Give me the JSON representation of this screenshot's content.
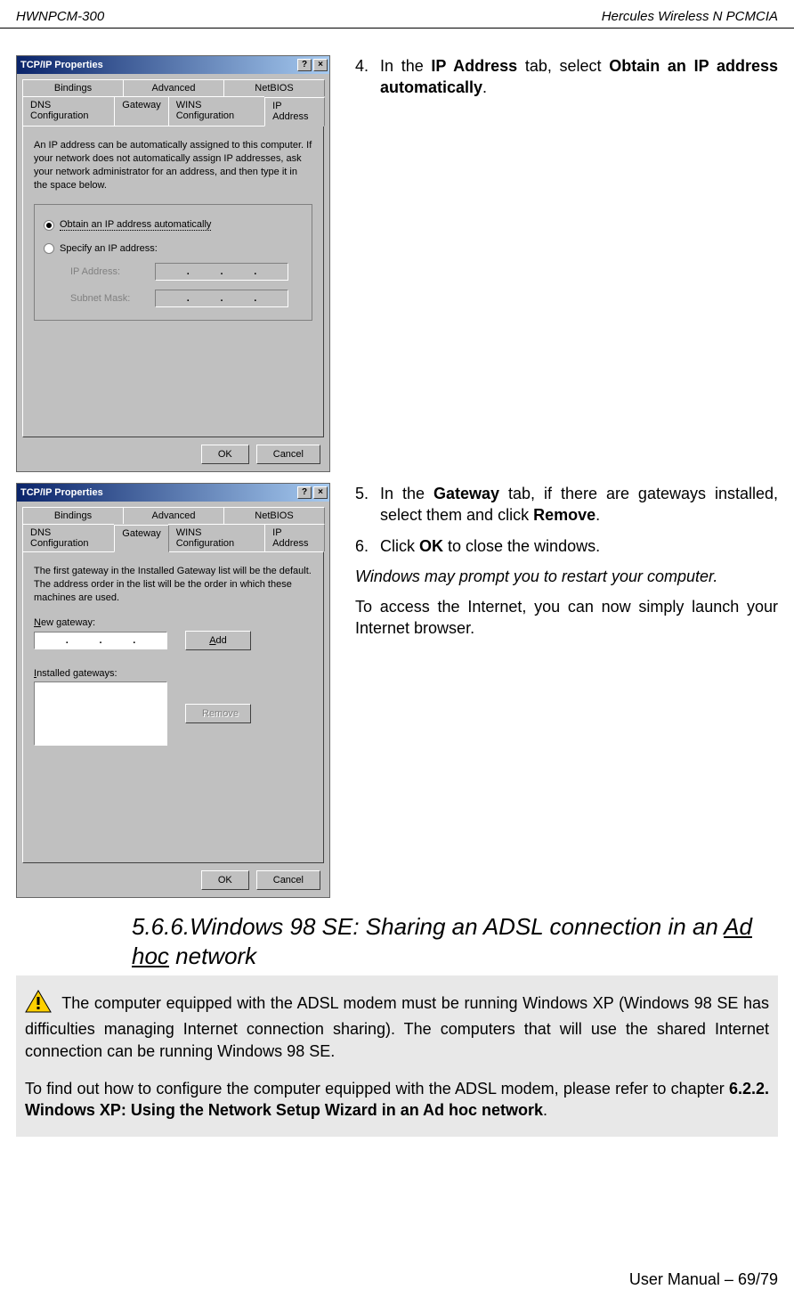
{
  "header": {
    "left": "HWNPCM-300",
    "right": "Hercules Wireless N PCMCIA"
  },
  "dialog1": {
    "title": "TCP/IP Properties",
    "help": "?",
    "close": "×",
    "tabs_row1": [
      "Bindings",
      "Advanced",
      "NetBIOS"
    ],
    "tabs_row2": [
      "DNS Configuration",
      "Gateway",
      "WINS Configuration",
      "IP Address"
    ],
    "desc": "An IP address can be automatically assigned to this computer. If your network does not automatically assign IP addresses, ask your network administrator for an address, and then type it in the space below.",
    "radio_auto": "Obtain an IP address automatically",
    "radio_specify": "Specify an IP address:",
    "ip_label": "IP Address:",
    "mask_label": "Subnet Mask:",
    "ok": "OK",
    "cancel": "Cancel"
  },
  "instr1": {
    "num": "4.",
    "text_a": "In the ",
    "text_b": "IP Address",
    "text_c": " tab, select ",
    "text_d": "Obtain an IP address automatically",
    "text_e": "."
  },
  "dialog2": {
    "title": "TCP/IP Properties",
    "help": "?",
    "close": "×",
    "tabs_row1": [
      "Bindings",
      "Advanced",
      "NetBIOS"
    ],
    "tabs_row2": [
      "DNS Configuration",
      "Gateway",
      "WINS Configuration",
      "IP Address"
    ],
    "desc": "The first gateway in the Installed Gateway list will be the default. The address order in the list will be the order in which these machines are used.",
    "new_gw": "New gateway:",
    "add": "Add",
    "installed": "Installed gateways:",
    "remove": "Remove",
    "ok": "OK",
    "cancel": "Cancel"
  },
  "instr2": {
    "s5_num": "5.",
    "s5_a": "In the ",
    "s5_b": "Gateway",
    "s5_c": " tab, if there are gateways installed, select them and click ",
    "s5_d": "Remove",
    "s5_e": ".",
    "s6_num": "6.",
    "s6_a": "Click ",
    "s6_b": "OK",
    "s6_c": " to close the windows.",
    "prompt": "Windows may prompt you to restart your computer.",
    "access": "To access the Internet, you can now simply launch your Internet browser."
  },
  "section": {
    "num": "5.6.6.",
    "title_a": "Windows 98 SE: Sharing an ADSL connection in an ",
    "title_b": "Ad hoc",
    "title_c": " network"
  },
  "note": {
    "p1": " The computer equipped with the ADSL modem must be running Windows XP (Windows 98 SE has difficulties managing Internet connection sharing).  The computers that will use the shared Internet connection can be running Windows 98 SE.",
    "p2_a": "To find out how to configure the computer equipped with the ADSL modem, please refer to chapter ",
    "p2_b": "6.2.2. Windows XP: Using the Network Setup Wizard in an Ad hoc network",
    "p2_c": "."
  },
  "footer": "User Manual – 69/79"
}
